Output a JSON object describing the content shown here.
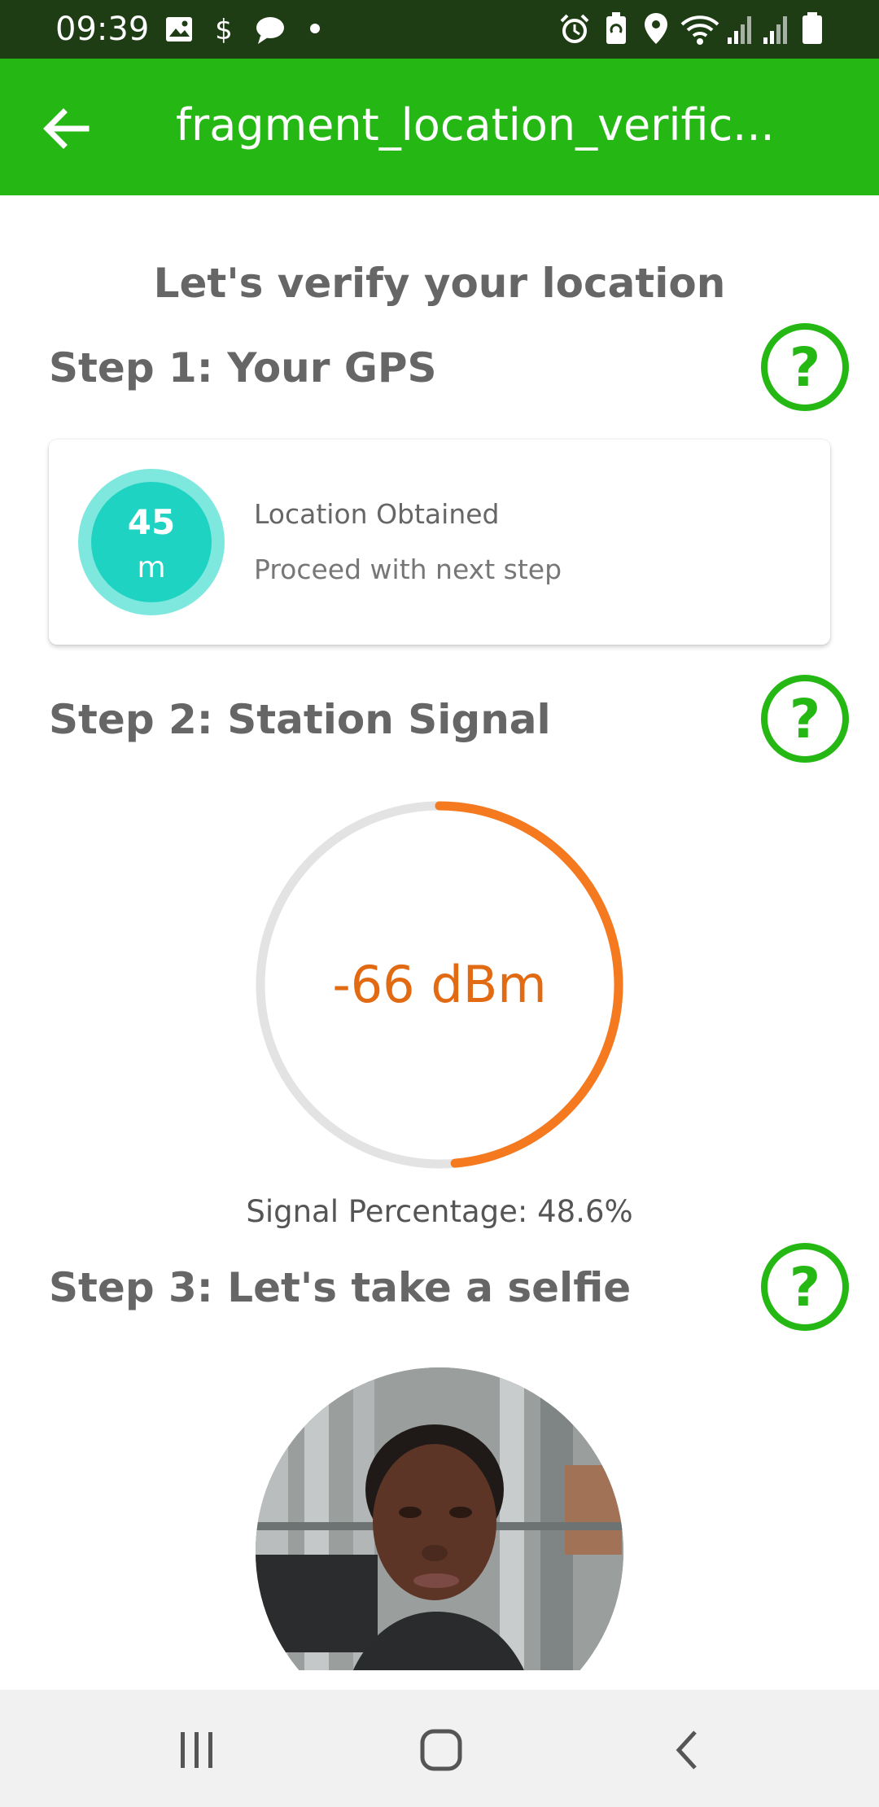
{
  "status_bar": {
    "time": "09:39",
    "icons": [
      "image-icon",
      "dollar-icon",
      "chat-icon",
      "dot-icon",
      "alarm-icon",
      "battery-saver-icon",
      "location-pin-icon",
      "wifi-icon",
      "signal-icon",
      "signal-icon",
      "battery-icon"
    ],
    "background": "#1e3d14"
  },
  "app_bar": {
    "title": "fragment_location_verific...",
    "back_icon": "arrow-left-icon",
    "background": "#25b814"
  },
  "page": {
    "heading": "Let's verify your location"
  },
  "step1": {
    "title": "Step 1: Your GPS",
    "help_icon": "help-circle-icon",
    "accuracy_value": "45",
    "accuracy_unit": "m",
    "status": "Location Obtained",
    "hint": "Proceed with next step"
  },
  "step2": {
    "title": "Step 2: Station Signal",
    "help_icon": "help-circle-icon",
    "signal_value": "-66 dBm",
    "signal_percentage_text": "Signal Percentage: 48.6%",
    "signal_fraction": 0.486,
    "gauge_color": "#f57a1f",
    "track_color": "#e3e3e3"
  },
  "step3": {
    "title": "Step 3: Let's take a selfie",
    "help_icon": "help-circle-icon",
    "photo": "selfie-photo"
  },
  "nav_bar": {
    "icons": [
      "recent-apps-icon",
      "home-icon",
      "back-icon"
    ]
  },
  "colors": {
    "accent_green": "#25b814",
    "teal": "#1fd3c3",
    "signal_orange": "#e26a12"
  }
}
